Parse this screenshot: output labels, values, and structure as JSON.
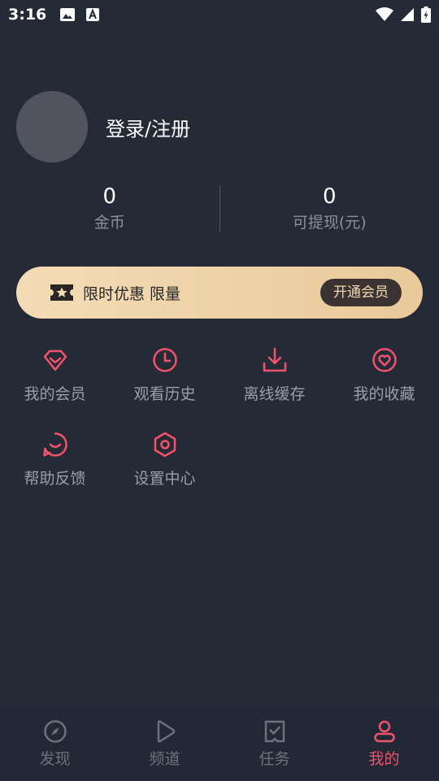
{
  "status_bar": {
    "time": "3:16"
  },
  "profile": {
    "login_label": "登录/注册"
  },
  "stats": [
    {
      "value": "0",
      "label": "金币"
    },
    {
      "value": "0",
      "label": "可提现(元)"
    }
  ],
  "vip": {
    "promo_text": "限时优惠 限量",
    "button_label": "开通会员"
  },
  "menu": [
    {
      "label": "我的会员",
      "icon": "diamond-icon"
    },
    {
      "label": "观看历史",
      "icon": "clock-icon"
    },
    {
      "label": "离线缓存",
      "icon": "download-icon"
    },
    {
      "label": "我的收藏",
      "icon": "heart-icon"
    },
    {
      "label": "帮助反馈",
      "icon": "feedback-icon"
    },
    {
      "label": "设置中心",
      "icon": "settings-icon"
    }
  ],
  "tabs": [
    {
      "label": "发现",
      "icon": "compass-icon",
      "active": false
    },
    {
      "label": "频道",
      "icon": "play-icon",
      "active": false
    },
    {
      "label": "任务",
      "icon": "task-icon",
      "active": false
    },
    {
      "label": "我的",
      "icon": "user-icon",
      "active": true
    }
  ],
  "colors": {
    "accent": "#f2526c",
    "background": "#252a37",
    "vip_gold": "#e9c99b"
  }
}
